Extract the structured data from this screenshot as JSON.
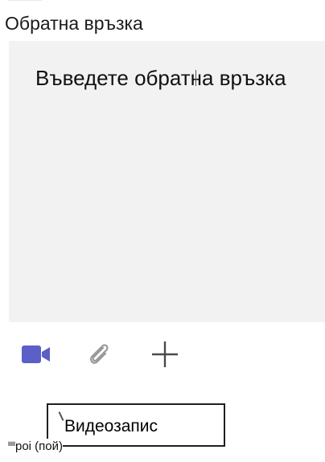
{
  "feedback": {
    "section_label": "Обратна връзка",
    "placeholder": "Въведете обратна връзка",
    "background_color": "#f2f2f2"
  },
  "toolbar": {
    "video_icon": "video-camera-icon",
    "attach_icon": "paperclip-icon",
    "add_icon": "plus-icon",
    "accent_color": "#5b5fc7"
  },
  "tooltip": {
    "text": "Видеозапис"
  },
  "footer": {
    "caption": "poi (пой)"
  }
}
